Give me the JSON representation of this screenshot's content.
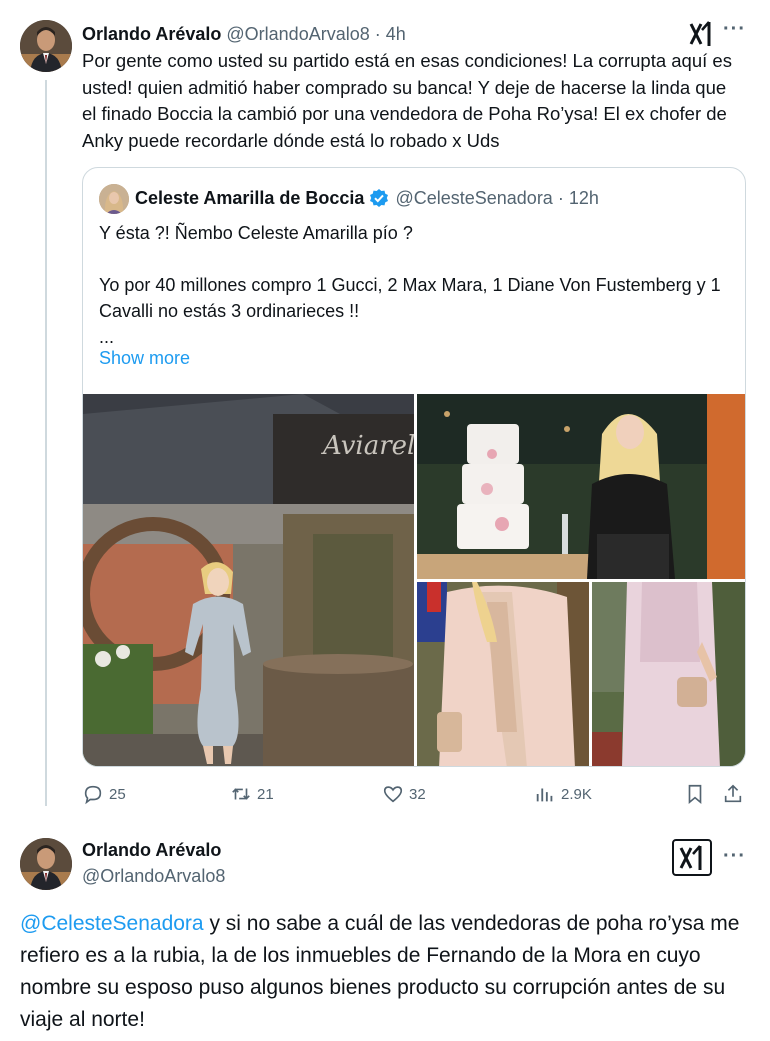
{
  "tweet1": {
    "display_name": "Orlando Arévalo",
    "handle": "@OrlandoArvalo8",
    "separator": "·",
    "time": "4h",
    "more_icon": "more-dots",
    "grok_icon": "grok-icon",
    "text": "Por gente como usted su partido está en esas condiciones! La corrupta aquí es usted! quien admitió haber comprado su banca! Y deje de hacerse la linda que el finado Boccia la cambió por una vendedora de Poha Ro’ysa! El ex chofer de Anky puede recordarle dónde está lo robado x Uds"
  },
  "quote": {
    "display_name": "Celeste Amarilla de Boccia",
    "handle": "@CelesteSenadora",
    "separator": "·",
    "time": "12h",
    "verified_color": "#1d9bf0",
    "lines": [
      "Y ésta ?!   Ñembo  Celeste Amarilla pío ?",
      "",
      "Yo por 40 millones compro 1 Gucci, 2 Max Mara, 1 Diane Von Fustemberg y 1 Cavalli no estás 3 ordinarieces !!",
      "..."
    ],
    "show_more": "Show more"
  },
  "actions": {
    "replies": "25",
    "reposts": "21",
    "likes": "32",
    "views": "2.9K"
  },
  "tweet2": {
    "display_name": "Orlando Arévalo",
    "handle": "@OrlandoArvalo8",
    "mention": "@CelesteSenadora",
    "text": " y si no sabe a cuál de las vendedoras de poha ro’ysa me refiero es a la rubia, la de los inmuebles de Fernando de la Mora en cuyo nombre su esposo puso algunos bienes producto su corrupción antes de su viaje al norte!"
  },
  "colors": {
    "accent": "#1d9bf0",
    "text": "#0f1419",
    "muted": "#536471",
    "border": "#cfd9de"
  }
}
